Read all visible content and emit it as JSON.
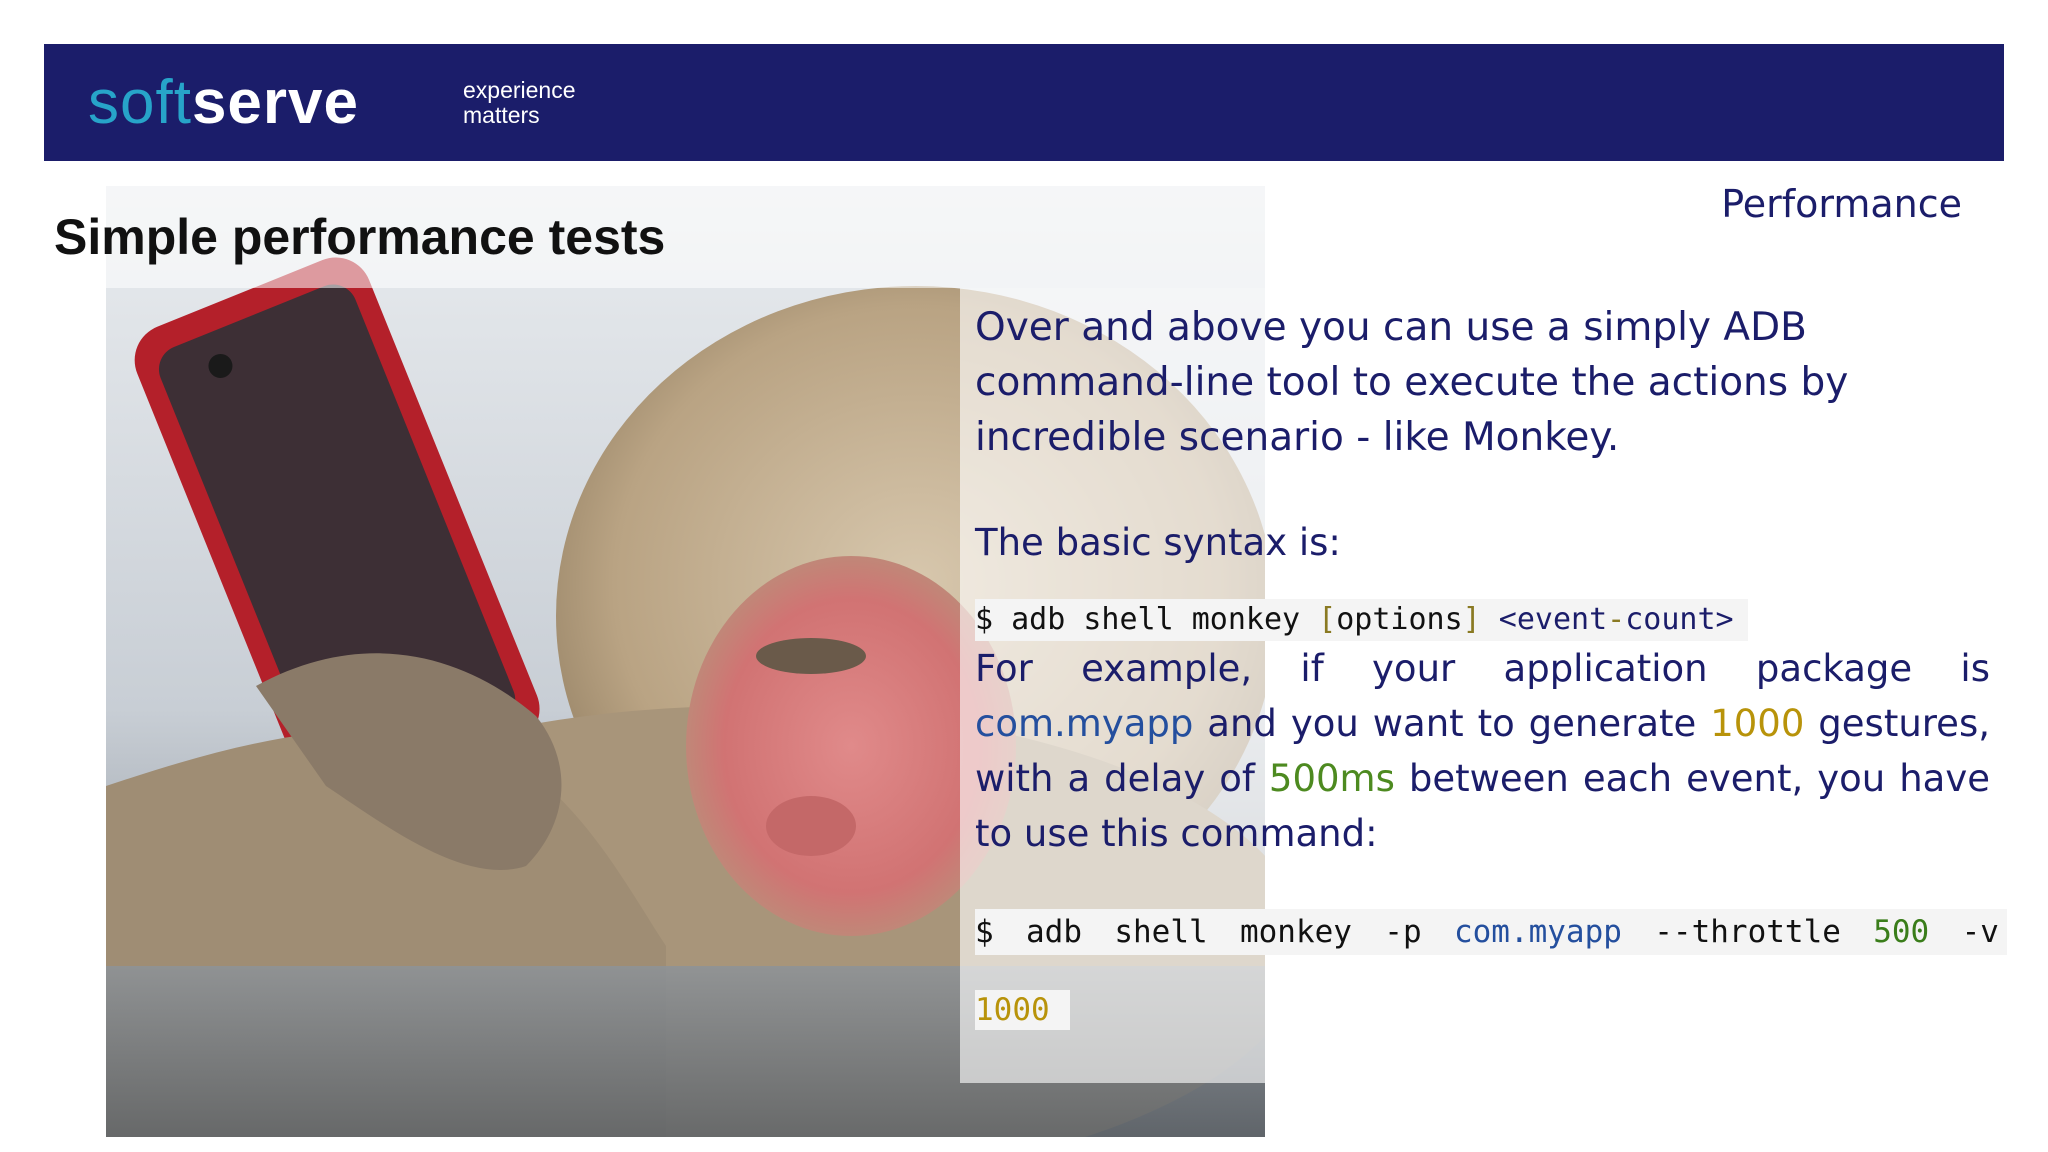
{
  "header": {
    "logo_soft": "soft",
    "logo_serve": "serve",
    "tagline_line1": "experience",
    "tagline_line2": "matters",
    "brand_color": "#1b1d6a",
    "logo_accent_color": "#27a4c9"
  },
  "slide": {
    "title": "Simple performance tests",
    "section": "Performance"
  },
  "content": {
    "intro": "Over and above you can use a simply ADB command-line tool to execute the actions by incredible scenario - like Monkey.",
    "syntax_label": "The basic syntax is:",
    "syntax_code": {
      "prefix": "$ adb shell monkey ",
      "bracket_open": "[",
      "options": "options",
      "bracket_close": "]",
      "space": " ",
      "event_open": "<event",
      "event_dash": "-",
      "event_close": "count>"
    },
    "example": {
      "part1": "For example, if your application package is ",
      "package": "com.myapp",
      "part2": " and you want to generate ",
      "count": "1000",
      "part3": " gestures, with a delay of ",
      "delay": "500ms",
      "part4": " between each event, you have to use this command:"
    },
    "command": {
      "dollar": "$",
      "adb": "adb",
      "shell": "shell",
      "monkey": "monkey",
      "flag_p": "-p",
      "package": "com.myapp",
      "flag_throttle": "--throttle",
      "throttle_value": "500",
      "flag_v": "-v",
      "count": "1000"
    }
  },
  "image": {
    "subject": "snow monkey holding a smartphone",
    "phone_color": "#b4202a"
  }
}
